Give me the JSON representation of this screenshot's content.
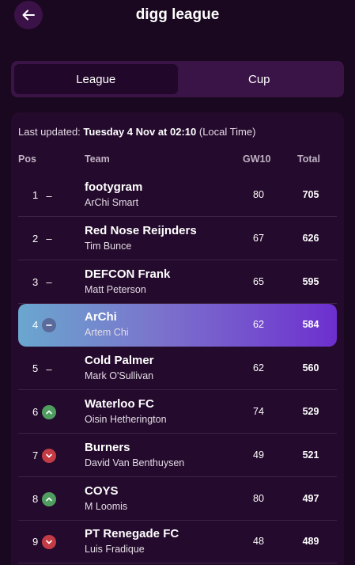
{
  "header": {
    "title": "digg league",
    "back_icon": "arrow-left-icon"
  },
  "tabs": [
    {
      "label": "League",
      "active": true
    },
    {
      "label": "Cup",
      "active": false
    }
  ],
  "last_updated": {
    "prefix": "Last updated:",
    "datetime": "Tuesday 4 Nov at 02:10",
    "suffix": "(Local Time)"
  },
  "columns": {
    "pos": "Pos",
    "team": "Team",
    "gw": "GW10",
    "total": "Total"
  },
  "colors": {
    "up": "#4f9e5f",
    "down": "#c33c45",
    "highlight_start": "#6aa7cf",
    "highlight_end": "#6d2fcf"
  },
  "rows": [
    {
      "pos": "1",
      "movement": "same",
      "team": "footygram",
      "manager": "ArChi Smart",
      "gw": "80",
      "total": "705"
    },
    {
      "pos": "2",
      "movement": "same",
      "team": "Red Nose Reijnders",
      "manager": "Tim Bunce",
      "gw": "67",
      "total": "626"
    },
    {
      "pos": "3",
      "movement": "same",
      "team": "DEFCON Frank",
      "manager": "Matt Peterson",
      "gw": "65",
      "total": "595"
    },
    {
      "pos": "4",
      "movement": "same",
      "team": "ArChi",
      "manager": "Artem Chi",
      "gw": "62",
      "total": "584",
      "highlight": true
    },
    {
      "pos": "5",
      "movement": "same",
      "team": "Cold Palmer",
      "manager": "Mark O'Sullivan",
      "gw": "62",
      "total": "560"
    },
    {
      "pos": "6",
      "movement": "up",
      "team": "Waterloo FC",
      "manager": "Oisin Hetherington",
      "gw": "74",
      "total": "529"
    },
    {
      "pos": "7",
      "movement": "down",
      "team": "Burners",
      "manager": "David Van Benthuysen",
      "gw": "49",
      "total": "521"
    },
    {
      "pos": "8",
      "movement": "up",
      "team": "COYS",
      "manager": "M Loomis",
      "gw": "80",
      "total": "497"
    },
    {
      "pos": "9",
      "movement": "down",
      "team": "PT Renegade FC",
      "manager": "Luis Fradique",
      "gw": "48",
      "total": "489"
    }
  ]
}
